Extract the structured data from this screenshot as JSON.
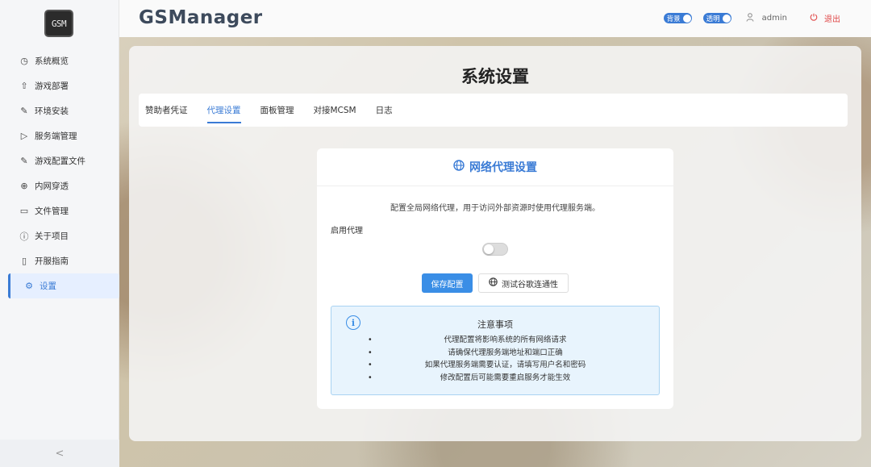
{
  "logo_text": "GSM",
  "brand": "GSManager",
  "header": {
    "toggles": [
      {
        "label": "背景",
        "state": "on"
      },
      {
        "label": "透明",
        "state": "on"
      }
    ],
    "user": "admin",
    "logout": "退出"
  },
  "sidebar": {
    "items": [
      {
        "label": "系统概览",
        "icon": "dashboard-icon"
      },
      {
        "label": "游戏部署",
        "icon": "rocket-icon"
      },
      {
        "label": "环境安装",
        "icon": "wrench-icon"
      },
      {
        "label": "服务端管理",
        "icon": "play-circle-icon"
      },
      {
        "label": "游戏配置文件",
        "icon": "tool-icon"
      },
      {
        "label": "内网穿透",
        "icon": "globe-icon"
      },
      {
        "label": "文件管理",
        "icon": "folder-icon"
      },
      {
        "label": "关于项目",
        "icon": "info-icon"
      },
      {
        "label": "开服指南",
        "icon": "book-icon"
      },
      {
        "label": "设置",
        "icon": "gear-icon",
        "active": true
      }
    ],
    "collapse": "<"
  },
  "page_title": "系统设置",
  "tabs": [
    {
      "label": "赞助者凭证"
    },
    {
      "label": "代理设置",
      "active": true
    },
    {
      "label": "面板管理"
    },
    {
      "label": "对接MCSM"
    },
    {
      "label": "日志"
    }
  ],
  "card": {
    "title": "网络代理设置",
    "description": "配置全局网络代理，用于访问外部资源时使用代理服务端。",
    "enable_label": "启用代理",
    "enable_state": "off",
    "save_button": "保存配置",
    "test_button": "测试谷歌连通性"
  },
  "notice": {
    "title": "注意事项",
    "items": [
      "代理配置将影响系统的所有网络请求",
      "请确保代理服务端地址和端口正确",
      "如果代理服务端需要认证，请填写用户名和密码",
      "修改配置后可能需要重启服务才能生效"
    ]
  },
  "colors": {
    "accent": "#3a7bd5",
    "primary_button": "#3a8ee6",
    "logout": "#e04848",
    "notice_bg": "#e8f4fd"
  }
}
